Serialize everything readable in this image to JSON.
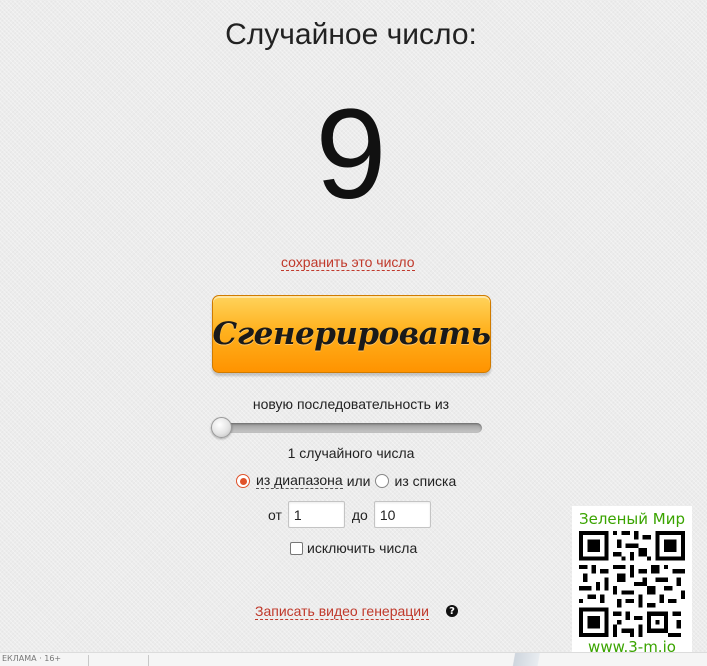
{
  "result": {
    "title": "Случайное число:",
    "value": "9",
    "save_link": "сохранить это число"
  },
  "generate_button": "Сгенерировать",
  "sequence": {
    "label": "новую последовательность из",
    "slider_value": 1,
    "count_label": "1 случайного числа"
  },
  "mode": {
    "range_label": "из диапазона",
    "or": "или",
    "list_label": "из списка",
    "selected": "range"
  },
  "range": {
    "from_label": "от",
    "from_value": "1",
    "to_label": "до",
    "to_value": "10"
  },
  "exclude": {
    "label": "исключить числа",
    "checked": false
  },
  "record_link": "Записать видео генерации",
  "promo": {
    "title": "Зеленый Мир",
    "url": "www.3-m.io"
  },
  "ad": {
    "label": "ЕКЛАМА · 16+"
  },
  "colors": {
    "link": "#c0392b",
    "button": "#ffa800",
    "radio_selected": "#e0522a",
    "promo_green": "#3aa400"
  }
}
